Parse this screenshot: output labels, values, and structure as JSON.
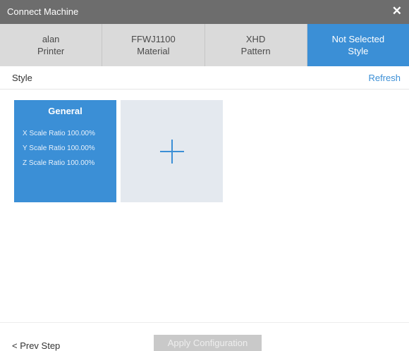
{
  "window": {
    "title": "Connect Machine",
    "close_glyph": "✕"
  },
  "tabs": [
    {
      "name": "alan",
      "label": "Printer",
      "active": false
    },
    {
      "name": "FFWJ1100",
      "label": "Material",
      "active": false
    },
    {
      "name": "XHD",
      "label": "Pattern",
      "active": false
    },
    {
      "name": "Not Selected",
      "label": "Style",
      "active": true
    }
  ],
  "section": {
    "title": "Style",
    "refresh": "Refresh"
  },
  "style_card": {
    "name": "General",
    "x_ratio": "X Scale Ratio  100.00%",
    "y_ratio": "Y Scale Ratio  100.00%",
    "z_ratio": "Z Scale Ratio  100.00%"
  },
  "add_card": {
    "icon": "plus-icon"
  },
  "footer": {
    "prev_step": "< Prev Step",
    "apply": "Apply Configuration"
  },
  "colors": {
    "accent": "#3b8fd6",
    "titlebar": "#6d6d6d",
    "tab_inactive": "#dadada",
    "add_card_bg": "#e4e9ef",
    "apply_disabled": "#c9c9c9"
  }
}
